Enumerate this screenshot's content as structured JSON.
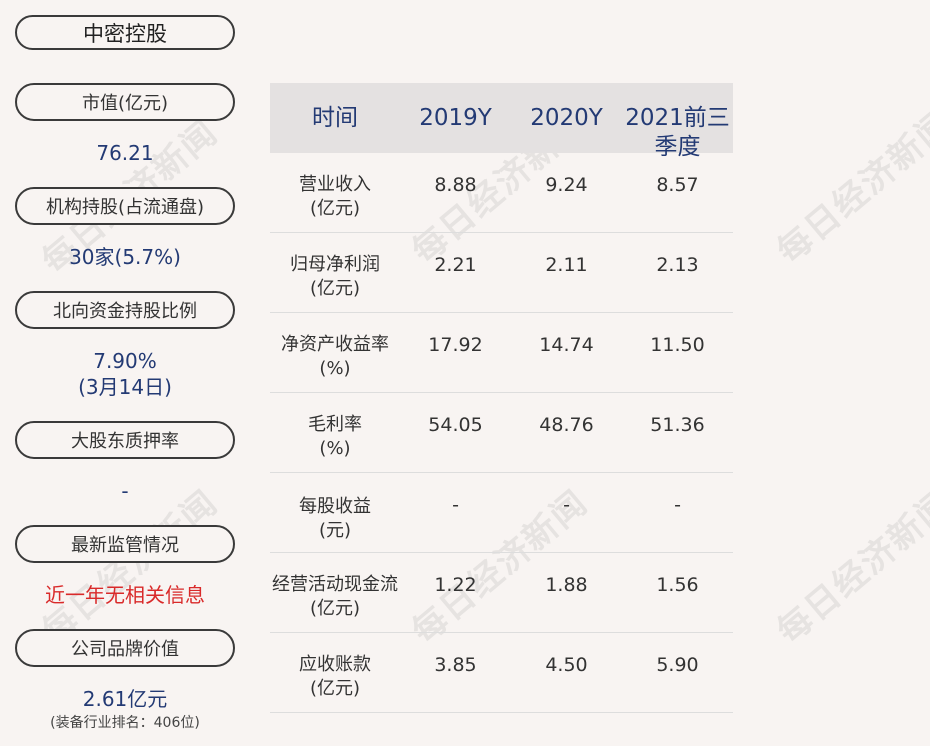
{
  "company": "中密控股",
  "watermark": "每日经济新闻",
  "left_panel": [
    {
      "label": "市值(亿元)",
      "value": "76.21"
    },
    {
      "label": "机构持股(占流通盘)",
      "value": "30家(5.7%)"
    },
    {
      "label": "北向资金持股比例",
      "value_line1": "7.90%",
      "value_line2": "(3月14日)"
    },
    {
      "label": "大股东质押率",
      "value": "-"
    },
    {
      "label": "最新监管情况",
      "value": "近一年无相关信息"
    },
    {
      "label": "公司品牌价值",
      "value": "2.61亿元",
      "note": "(装备行业排名：406位)"
    }
  ],
  "table": {
    "headers": [
      "时间",
      "2019Y",
      "2020Y",
      "2021前三季度"
    ],
    "rows": [
      {
        "metric_line1": "营业收入",
        "metric_line2": "(亿元)",
        "values": [
          "8.88",
          "9.24",
          "8.57"
        ]
      },
      {
        "metric_line1": "归母净利润",
        "metric_line2": "(亿元)",
        "values": [
          "2.21",
          "2.11",
          "2.13"
        ]
      },
      {
        "metric_line1": "净资产收益率",
        "metric_line2": "(%)",
        "values": [
          "17.92",
          "14.74",
          "11.50"
        ]
      },
      {
        "metric_line1": "毛利率",
        "metric_line2": "(%)",
        "values": [
          "54.05",
          "48.76",
          "51.36"
        ]
      },
      {
        "metric_line1": "每股收益",
        "metric_line2": "(元)",
        "values": [
          "-",
          "-",
          "-"
        ]
      },
      {
        "metric_line1": "经营活动现金流",
        "metric_line2": "(亿元)",
        "values": [
          "1.22",
          "1.88",
          "1.56"
        ]
      },
      {
        "metric_line1": "应收账款",
        "metric_line2": "(亿元)",
        "values": [
          "3.85",
          "4.50",
          "5.90"
        ]
      }
    ]
  },
  "colors": {
    "accent_blue": "#233a74",
    "alert_red": "#d92a2a",
    "header_bg": "#e4e1e1",
    "background": "#f8f4f2"
  }
}
